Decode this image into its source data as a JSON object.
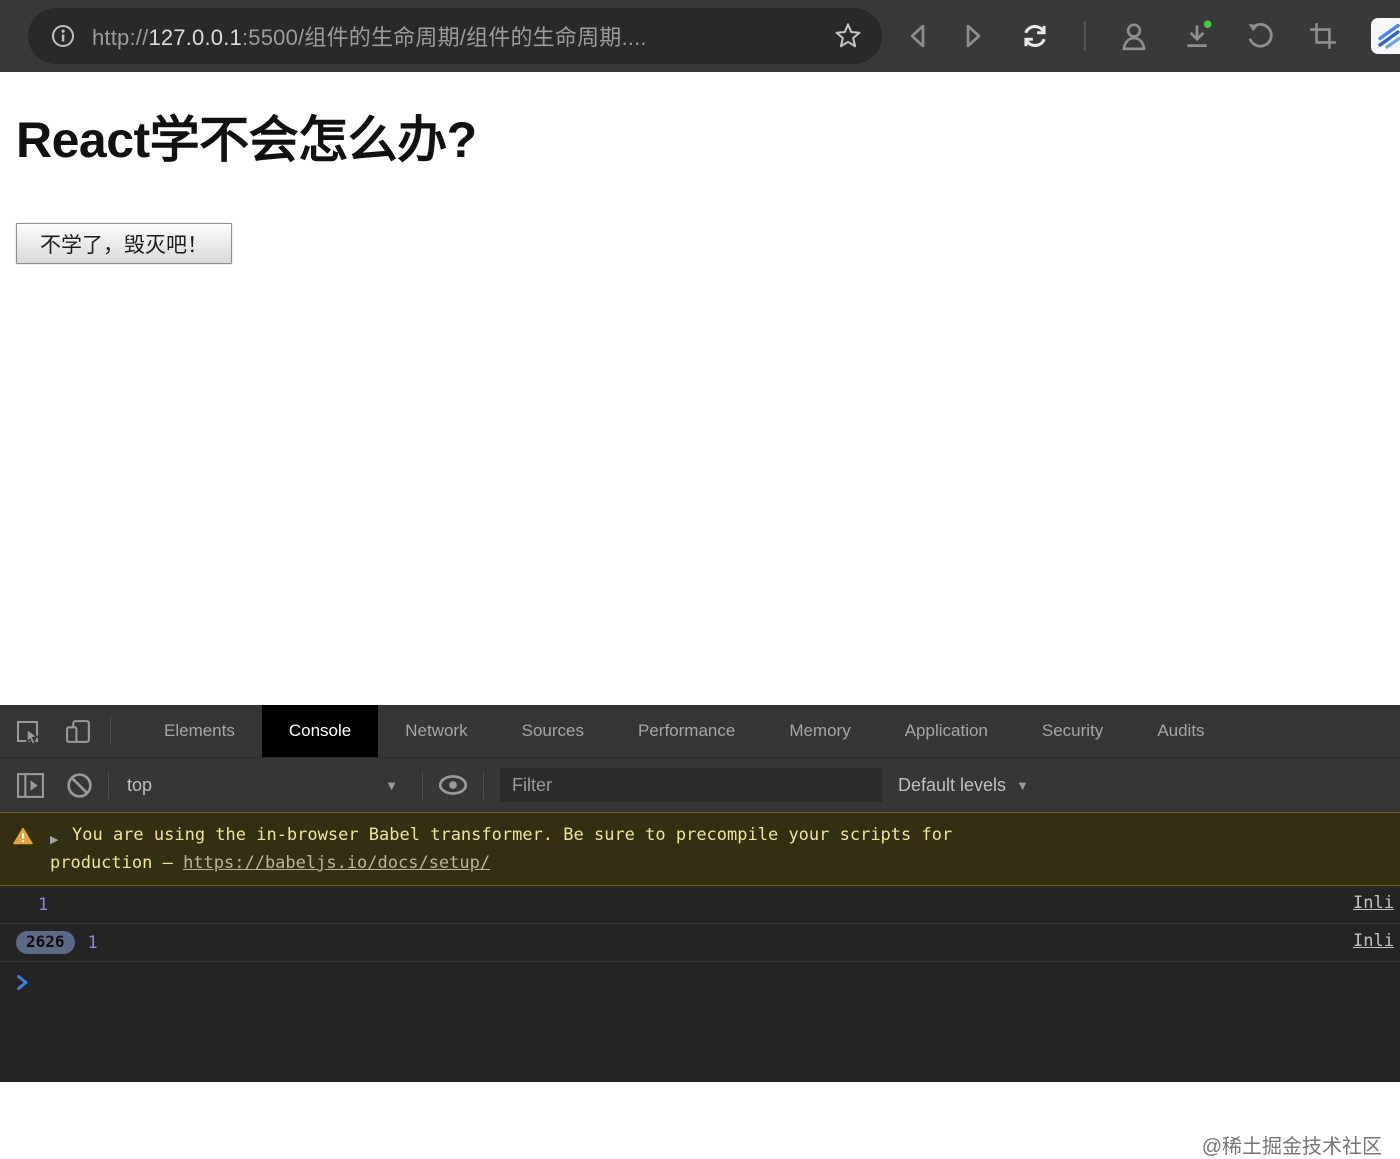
{
  "browser": {
    "url": {
      "scheme": "http://",
      "host": "127.0.0.1",
      "rest": ":5500/组件的生命周期/组件的生命周期...."
    }
  },
  "page": {
    "heading": "React学不会怎么办?",
    "button_label": "不学了，毁灭吧！"
  },
  "devtools": {
    "tabs": [
      "Elements",
      "Console",
      "Network",
      "Sources",
      "Performance",
      "Memory",
      "Application",
      "Security",
      "Audits"
    ],
    "active_tab": "Console",
    "toolbar": {
      "context": "top",
      "filter_placeholder": "Filter",
      "levels_label": "Default levels"
    },
    "console": {
      "warning": {
        "line1": "You are using the in-browser Babel transformer. Be sure to precompile your scripts for",
        "line2_prefix": "production – ",
        "link": "https://babeljs.io/docs/setup/"
      },
      "logs": [
        {
          "badge": "",
          "value": "1",
          "source": "Inli"
        },
        {
          "badge": "2626",
          "value": "1",
          "source": "Inli"
        }
      ]
    },
    "watermark": "@稀土掘金技术社区"
  },
  "icons": {
    "expand_arrow": "▶",
    "dropdown_arrow": "▼"
  },
  "colors": {
    "accent_blue": "#3f7ee8",
    "number_purple": "#9a7ee8",
    "badge_bg": "#5b6b87",
    "warning_bg": "#333012",
    "warning_border": "#6a5d21",
    "warning_text": "#f0e39a",
    "warning_icon_orange": "#e8a33d",
    "green_dot": "#43cb3e"
  }
}
